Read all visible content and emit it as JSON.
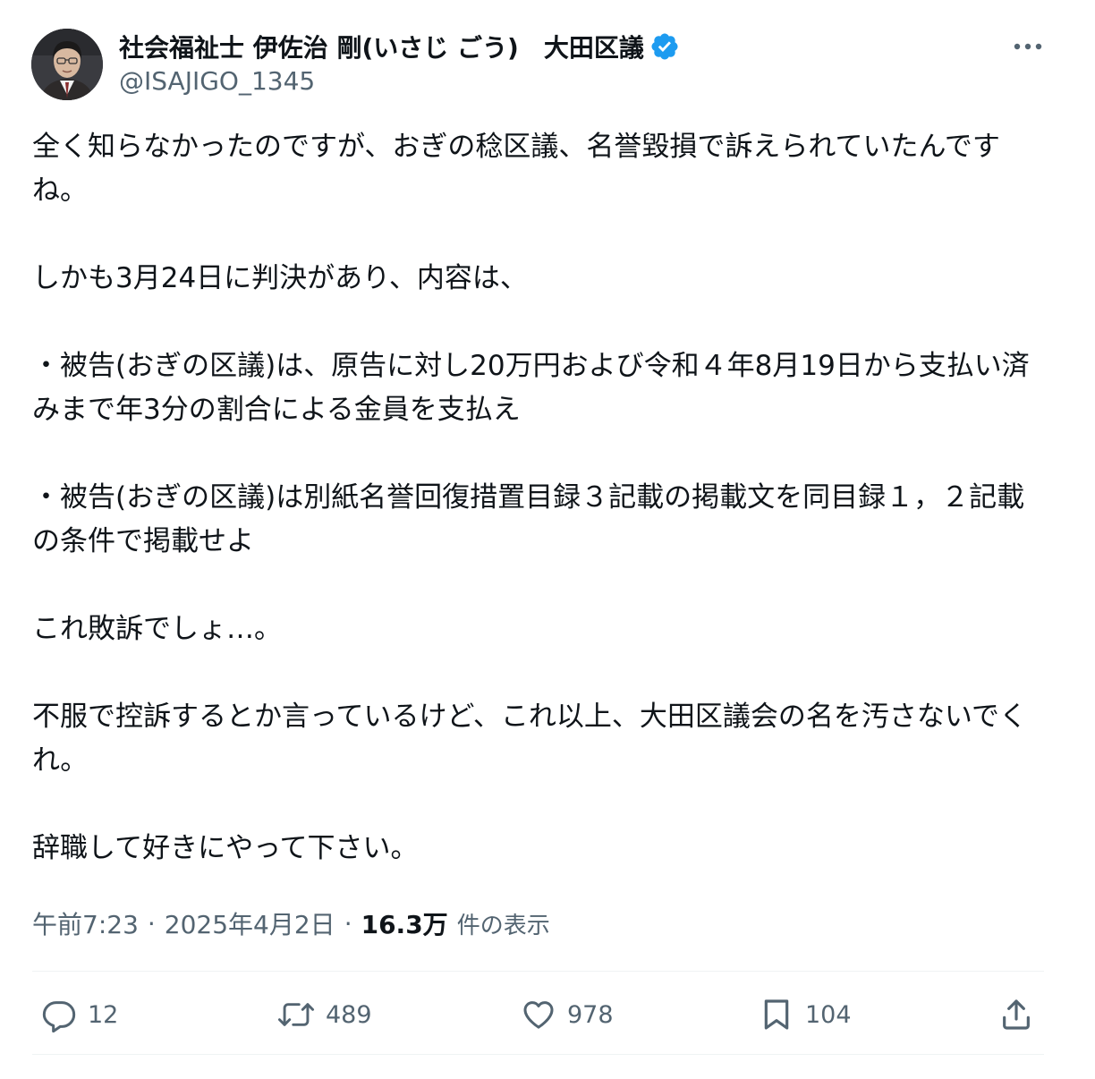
{
  "author": {
    "display_name": "社会福祉士 伊佐治 剛(いさじ ごう)　大田区議",
    "handle": "@ISAJIGO_1345",
    "verified": true,
    "verified_color": "#1d9bf0"
  },
  "body": {
    "paragraphs": [
      "全く知らなかったのですが、おぎの稔区議、名誉毀損で訴えられていたんですね。",
      "しかも3月24日に判決があり、内容は、",
      "・被告(おぎの区議)は、原告に対し20万円および令和４年8月19日から支払い済みまで年3分の割合による金員を支払え",
      "・被告(おぎの区議)は別紙名誉回復措置目録３記載の掲載文を同目録１，２記載の条件で掲載せよ",
      "これ敗訴でしょ…。",
      "不服で控訴するとか言っているけど、これ以上、大田区議会の名を汚さないでくれ。",
      "辞職して好きにやって下さい。"
    ]
  },
  "meta": {
    "time": "午前7:23",
    "separator": "·",
    "date": "2025年4月2日",
    "views_count": "16.3万",
    "views_label": "件の表示"
  },
  "actions": {
    "replies": "12",
    "reposts": "489",
    "likes": "978",
    "bookmarks": "104"
  },
  "icons": {
    "more": "more-icon",
    "reply": "reply-icon",
    "repost": "repost-icon",
    "like": "heart-icon",
    "bookmark": "bookmark-icon",
    "share": "share-icon"
  },
  "colors": {
    "text": "#0f1419",
    "secondary": "#536471",
    "divider": "#eff3f4"
  }
}
